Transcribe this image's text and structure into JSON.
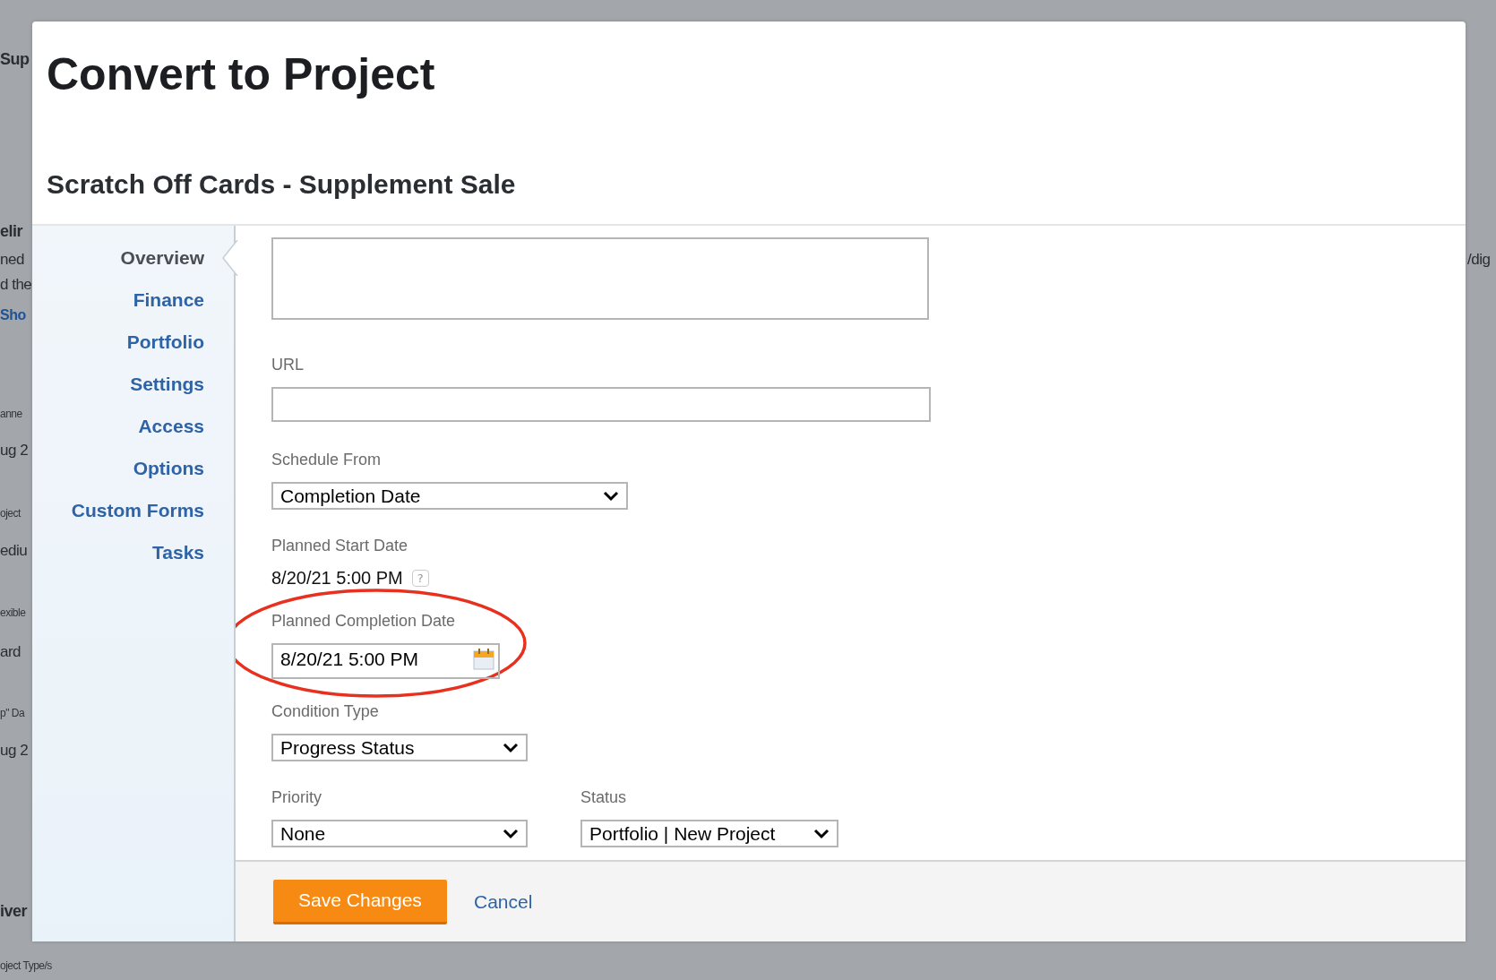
{
  "backdrop": {
    "left_fragments": [
      {
        "text": "Sup",
        "kind": "heading"
      },
      {
        "text": "elir",
        "kind": "heading"
      },
      {
        "text": "ned",
        "kind": "body"
      },
      {
        "text": "d the",
        "kind": "body"
      },
      {
        "text": "Sho",
        "kind": "link"
      },
      {
        "text": "anne",
        "kind": "label"
      },
      {
        "text": "ug 2",
        "kind": "body"
      },
      {
        "text": "oject",
        "kind": "label"
      },
      {
        "text": "ediu",
        "kind": "body"
      },
      {
        "text": "exible",
        "kind": "label"
      },
      {
        "text": "ard",
        "kind": "body"
      },
      {
        "text": "p\" Da",
        "kind": "label"
      },
      {
        "text": "ug 2",
        "kind": "body"
      },
      {
        "text": "iver",
        "kind": "heading"
      },
      {
        "text": "oject Type/s",
        "kind": "label"
      }
    ],
    "right_fragments": [
      {
        "text": "/dig",
        "kind": "body"
      }
    ]
  },
  "dialog": {
    "title": "Convert to Project",
    "subtitle": "Scratch Off Cards - Supplement Sale",
    "nav": [
      {
        "label": "Overview",
        "selected": true
      },
      {
        "label": "Finance",
        "selected": false
      },
      {
        "label": "Portfolio",
        "selected": false
      },
      {
        "label": "Settings",
        "selected": false
      },
      {
        "label": "Access",
        "selected": false
      },
      {
        "label": "Options",
        "selected": false
      },
      {
        "label": "Custom Forms",
        "selected": false
      },
      {
        "label": "Tasks",
        "selected": false
      }
    ],
    "fields": [
      {
        "kind": "textarea"
      },
      {
        "kind": "text",
        "label": "URL"
      },
      {
        "kind": "select",
        "label": "Schedule From",
        "value": "Completion Date"
      },
      {
        "kind": "readonly",
        "label": "Planned Start Date",
        "value": "8/20/21 5:00 PM",
        "help": "?"
      },
      {
        "kind": "date",
        "label": "Planned Completion Date",
        "value": "8/20/21 5:00 PM",
        "highlighted": true
      },
      {
        "kind": "select",
        "label": "Condition Type",
        "value": "Progress Status"
      },
      {
        "kind": "pair",
        "items": [
          {
            "label": "Priority",
            "value": "None"
          },
          {
            "label": "Status",
            "value": "Portfolio | New Project"
          }
        ]
      }
    ],
    "buttons": [
      {
        "label": "Save Changes",
        "kind": "primary"
      },
      {
        "label": "Cancel",
        "kind": "link"
      }
    ]
  }
}
